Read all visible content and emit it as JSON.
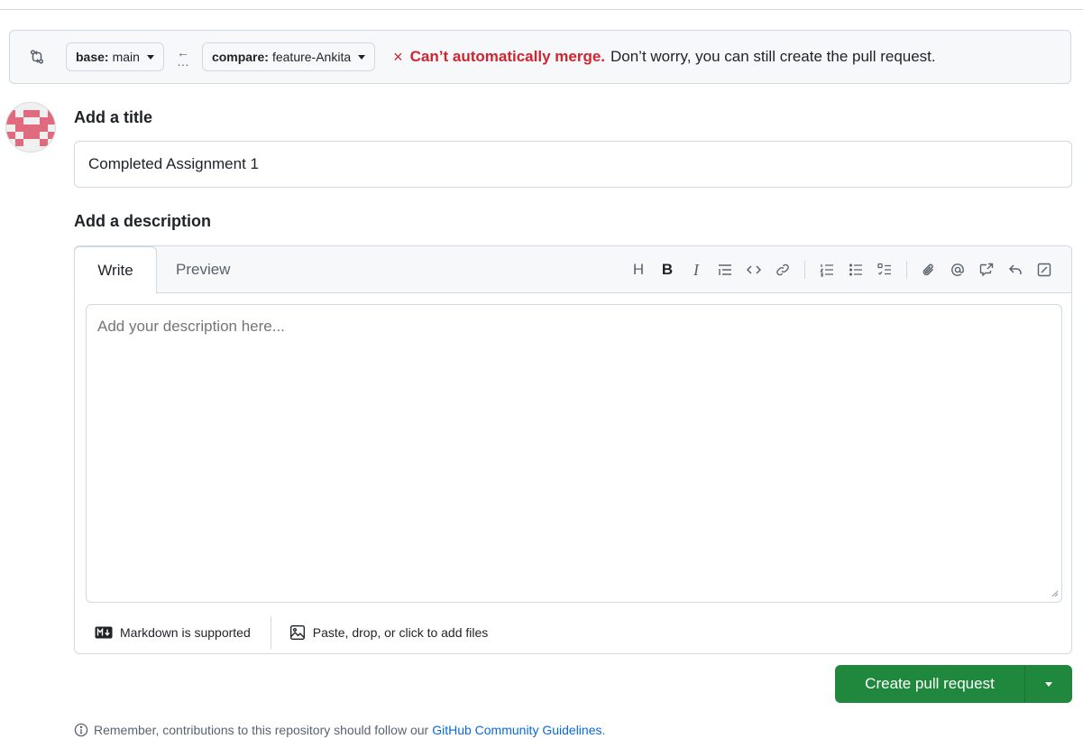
{
  "compare": {
    "base_label": "base:",
    "base_value": "main",
    "arrow_glyph": "←",
    "dots_glyph": "…",
    "compare_label": "compare:",
    "compare_value": "feature-Ankita",
    "status_icon": "×",
    "status_error": "Can’t automatically merge.",
    "status_message": "Don’t worry, you can still create the pull request."
  },
  "title_section": {
    "heading": "Add a title",
    "value": "Completed Assignment 1"
  },
  "description_section": {
    "heading": "Add a description",
    "tabs": [
      {
        "label": "Write",
        "active": true
      },
      {
        "label": "Preview",
        "active": false
      }
    ],
    "toolbar": {
      "heading_glyph": "H",
      "bold_glyph": "B",
      "italic_glyph": "I"
    },
    "placeholder": "Add your description here...",
    "markdown_note": "Markdown is supported",
    "attach_note": "Paste, drop, or click to add files"
  },
  "actions": {
    "create_label": "Create pull request"
  },
  "footer": {
    "reminder_text": "Remember, contributions to this repository should follow our",
    "reminder_link": "GitHub Community Guidelines",
    "reminder_end": "."
  },
  "colors": {
    "primary_green": "#1f883d",
    "danger_red": "#d1242f",
    "link_blue": "#0969da"
  }
}
